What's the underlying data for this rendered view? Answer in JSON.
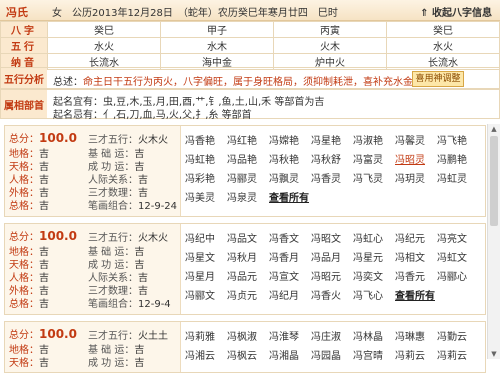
{
  "header": {
    "surname": "冯氏",
    "info": "女　公历2013年12月28日　（蛇年）农历癸巳年寒月廿四　巳时",
    "collect": "⇑ 收起八字信息"
  },
  "bazi": {
    "rows": [
      {
        "label": "八字",
        "cells": [
          "癸巳",
          "甲子",
          "丙寅",
          "癸巳"
        ]
      },
      {
        "label": "五行",
        "cells": [
          "水火",
          "水木",
          "火木",
          "水火"
        ]
      },
      {
        "label": "纳音",
        "cells": [
          "长流水",
          "海中金",
          "炉中火",
          "长流水"
        ]
      }
    ]
  },
  "analysis": {
    "label": "五行分析",
    "prefix": "总述：",
    "text": "命主日干五行为丙火，八字偏旺，属于身旺格局，须抑制耗泄，喜补充水金土，忌木火",
    "button": "喜用神调整"
  },
  "initial": {
    "label": "属相部首",
    "line1": "起名宜有：虫,豆,木,玉,月,田,酉,艹,钅,鱼,土,山,禾 等部首为吉",
    "line2": "起名忌有：亻,石,刀,血,马,火,父,扌,糸 等部首"
  },
  "cards": [
    {
      "score_label": "总分：",
      "score": "100.0",
      "sancai_label": "三才五行：",
      "sancai": "火木火",
      "left": [
        [
          "地格：",
          "吉"
        ],
        [
          "天格：",
          "吉"
        ],
        [
          "人格：",
          "吉"
        ],
        [
          "外格：",
          "吉"
        ],
        [
          "总格：",
          "吉"
        ]
      ],
      "mid": [
        [
          "基 础 运：",
          "吉"
        ],
        [
          "成 功 运：",
          "吉"
        ],
        [
          "人际关系：",
          "吉"
        ],
        [
          "三才数理：",
          "吉"
        ],
        [
          "笔画组合：",
          "12-9-24"
        ]
      ],
      "names": [
        "冯香艳",
        "冯红艳",
        "冯嫦艳",
        "冯星艳",
        "冯淑艳",
        "冯馨灵",
        "冯飞艳",
        "冯虹艳",
        "冯品艳",
        "冯秋艳",
        "冯秋舒",
        "冯富灵",
        "冯昭灵",
        "冯鹏艳",
        "冯彩艳",
        "冯郦灵",
        "冯飘灵",
        "冯香灵",
        "冯飞灵",
        "冯玥灵",
        "冯虹灵",
        "冯美灵",
        "冯泉灵"
      ],
      "highlight": "冯昭灵",
      "more": "查看所有"
    },
    {
      "score_label": "总分：",
      "score": "100.0",
      "sancai_label": "三才五行：",
      "sancai": "火木火",
      "left": [
        [
          "地格：",
          "吉"
        ],
        [
          "天格：",
          "吉"
        ],
        [
          "人格：",
          "吉"
        ],
        [
          "外格：",
          "吉"
        ],
        [
          "总格：",
          "吉"
        ]
      ],
      "mid": [
        [
          "基 础 运：",
          "吉"
        ],
        [
          "成 功 运：",
          "吉"
        ],
        [
          "人际关系：",
          "吉"
        ],
        [
          "三才数理：",
          "吉"
        ],
        [
          "笔画组合：",
          "12-9-4"
        ]
      ],
      "names": [
        "冯纪中",
        "冯品文",
        "冯香文",
        "冯昭文",
        "冯虹心",
        "冯纪元",
        "冯亮文",
        "冯星文",
        "冯秋月",
        "冯香月",
        "冯品月",
        "冯星元",
        "冯相文",
        "冯虹文",
        "冯星月",
        "冯品元",
        "冯宣文",
        "冯昭元",
        "冯奕文",
        "冯香元",
        "冯郦心",
        "冯郦文",
        "冯贞元",
        "冯纪月",
        "冯香火",
        "冯飞心"
      ],
      "more": "查看所有"
    },
    {
      "score_label": "总分：",
      "score": "100.0",
      "sancai_label": "三才五行：",
      "sancai": "火土土",
      "left": [
        [
          "地格：",
          "吉"
        ],
        [
          "天格：",
          "吉"
        ]
      ],
      "mid": [
        [
          "基 础 运：",
          "吉"
        ],
        [
          "成 功 运：",
          "吉"
        ]
      ],
      "names": [
        "冯莉雅",
        "冯枫淑",
        "冯淮琴",
        "冯庄淑",
        "冯林晶",
        "冯琳惠",
        "冯勤云",
        "冯湘云",
        "冯枫云",
        "冯湘晶",
        "冯园晶",
        "冯宫晴",
        "冯莉云",
        "冯莉云"
      ]
    }
  ],
  "colors": {
    "accent": "#c23a12",
    "label_bg": "#fbe9cf",
    "border": "#e8d7b8"
  }
}
